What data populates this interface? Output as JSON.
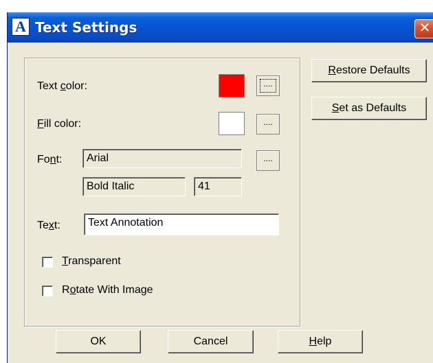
{
  "window": {
    "title": "Text Settings",
    "app_icon_letter": "A",
    "close_glyph": "✕"
  },
  "form": {
    "text_color": {
      "prefix": "Text ",
      "mnemonic": "c",
      "suffix": "olor:",
      "value": "#ff0000"
    },
    "fill_color": {
      "prefix": "",
      "mnemonic": "F",
      "suffix": "ill color:",
      "value": "#ffffff"
    },
    "font": {
      "label_prefix": "Fo",
      "label_mnemonic": "n",
      "label_suffix": "t:",
      "name": "Arial",
      "style": "Bold Italic",
      "size": "41"
    },
    "text": {
      "label_prefix": "Te",
      "label_mnemonic": "x",
      "label_suffix": "t:",
      "value": "Text Annotation"
    },
    "transparent": {
      "mnemonic": "T",
      "suffix": "ransparent",
      "checked": false
    },
    "rotate": {
      "prefix": "R",
      "mnemonic": "o",
      "suffix": "tate With Image",
      "checked": false
    },
    "ellipsis": "...."
  },
  "side_buttons": {
    "restore": {
      "mnemonic": "R",
      "suffix": "estore Defaults"
    },
    "set": {
      "mnemonic": "S",
      "suffix": "et as Defaults"
    }
  },
  "bottom_buttons": {
    "ok": "OK",
    "cancel": "Cancel",
    "help": {
      "mnemonic": "H",
      "suffix": "elp"
    }
  }
}
